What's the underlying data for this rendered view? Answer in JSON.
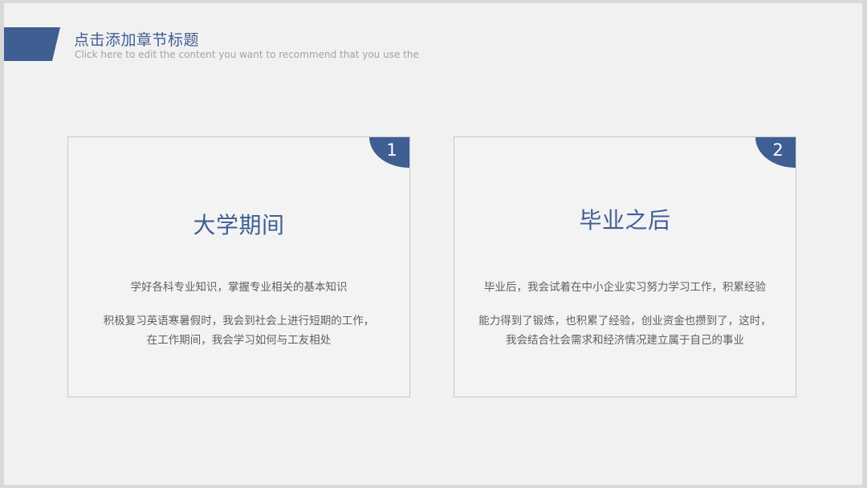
{
  "header": {
    "title": "点击添加章节标题",
    "subtitle": "Click here to edit the content you want to recommend that you use the"
  },
  "cards": [
    {
      "number": "1",
      "title": "大学期间",
      "lines": [
        "学好各科专业知识，掌握专业相关的基本知识",
        "积极复习英语寒暑假时，我会到社会上进行短期的工作，",
        "在工作期间，我会学习如何与工友相处"
      ]
    },
    {
      "number": "2",
      "title": "毕业之后",
      "lines": [
        "毕业后，我会试着在中小企业实习努力学习工作，积累经验",
        "能力得到了锻炼，也积累了经验，创业资金也攒到了，这时，",
        "我会结合社会需求和经济情况建立属于自己的事业"
      ]
    }
  ],
  "colors": {
    "accent": "#3f5e92",
    "background": "#f1f1f2",
    "card_border": "#c8c8cc",
    "body_text": "#5f5f64"
  }
}
